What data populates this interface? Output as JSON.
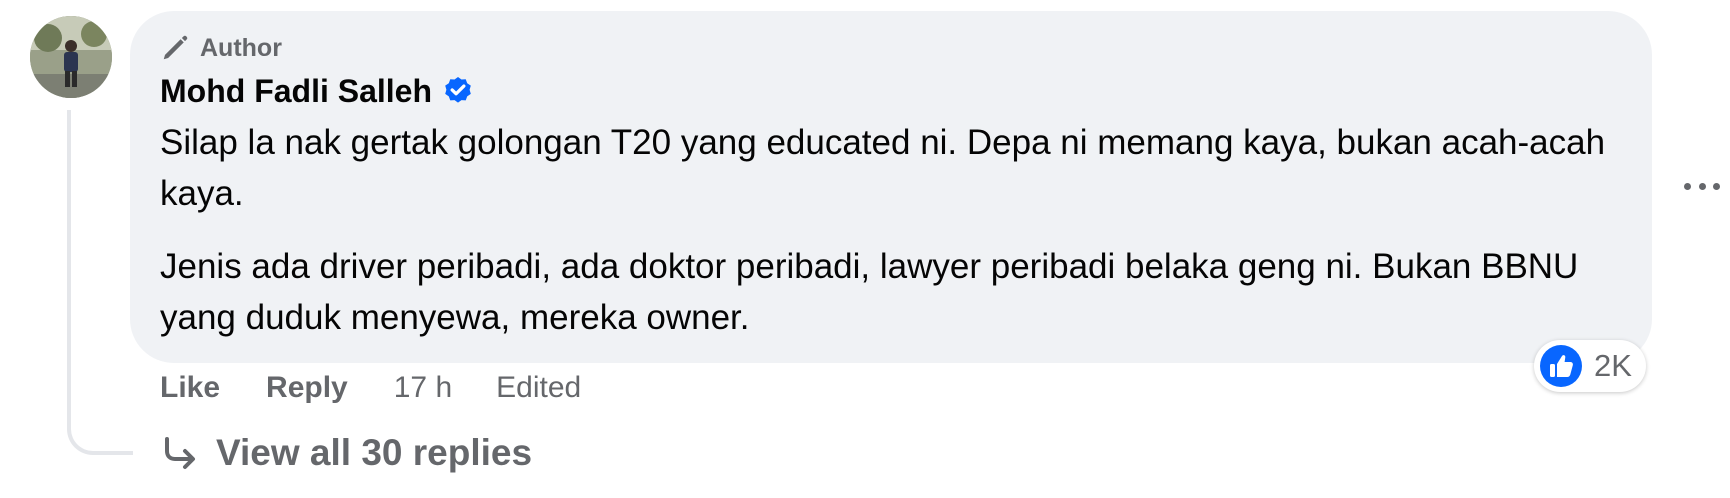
{
  "comment": {
    "author_badge": "Author",
    "author_name": "Mohd Fadli Salleh",
    "verified_icon": "verified-badge-icon",
    "paragraphs": [
      "Silap la nak gertak golongan T20 yang educated ni. Depa ni memang kaya, bukan acah-acah kaya.",
      "Jenis ada driver peribadi, ada doktor peribadi, lawyer peribadi belaka geng ni. Bukan BBNU yang duduk menyewa, mereka owner."
    ],
    "reaction_count": "2K",
    "reaction_icon": "like-reaction-icon"
  },
  "actions": {
    "like": "Like",
    "reply": "Reply",
    "time": "17 h",
    "edited": "Edited"
  },
  "replies": {
    "label": "View all 30 replies",
    "icon": "reply-arrow-icon"
  },
  "colors": {
    "bubble_bg": "#f0f2f5",
    "secondary_text": "#65676b",
    "primary_text": "#050505",
    "verified_blue": "#0866ff",
    "like_blue": "#0866ff"
  }
}
